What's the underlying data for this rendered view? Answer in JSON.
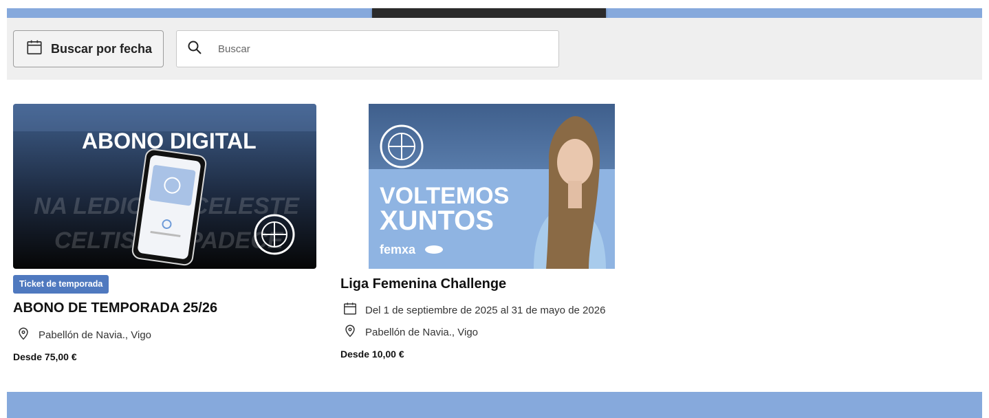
{
  "toolbar": {
    "date_button_label": "Buscar por fecha",
    "search_placeholder": "Buscar"
  },
  "events": [
    {
      "image": {
        "headline": "ABONO DIGITAL",
        "bg_text_1": "NA LEDICIÓN CELESTE",
        "bg_text_2": "CELTISTAS PADECE"
      },
      "badge": "Ticket de temporada",
      "title": "ABONO DE TEMPORADA 25/26",
      "venue": "Pabellón de Navia., Vigo",
      "price": "Desde 75,00 €"
    },
    {
      "image": {
        "headline_line_1": "VOLTEMOS",
        "headline_line_2": "XUNTOS",
        "sponsor": "femxa"
      },
      "title": "Liga Femenina Challenge",
      "dates": "Del 1 de septiembre de 2025 al 31 de mayo de 2026",
      "venue": "Pabellón de Navia., Vigo",
      "price": "Desde 10,00 €"
    }
  ],
  "colors": {
    "band": "#86a9dc",
    "toolbar_bg": "#efefef",
    "badge_bg": "#4f79bf",
    "overlay": "#2b2b2b"
  }
}
